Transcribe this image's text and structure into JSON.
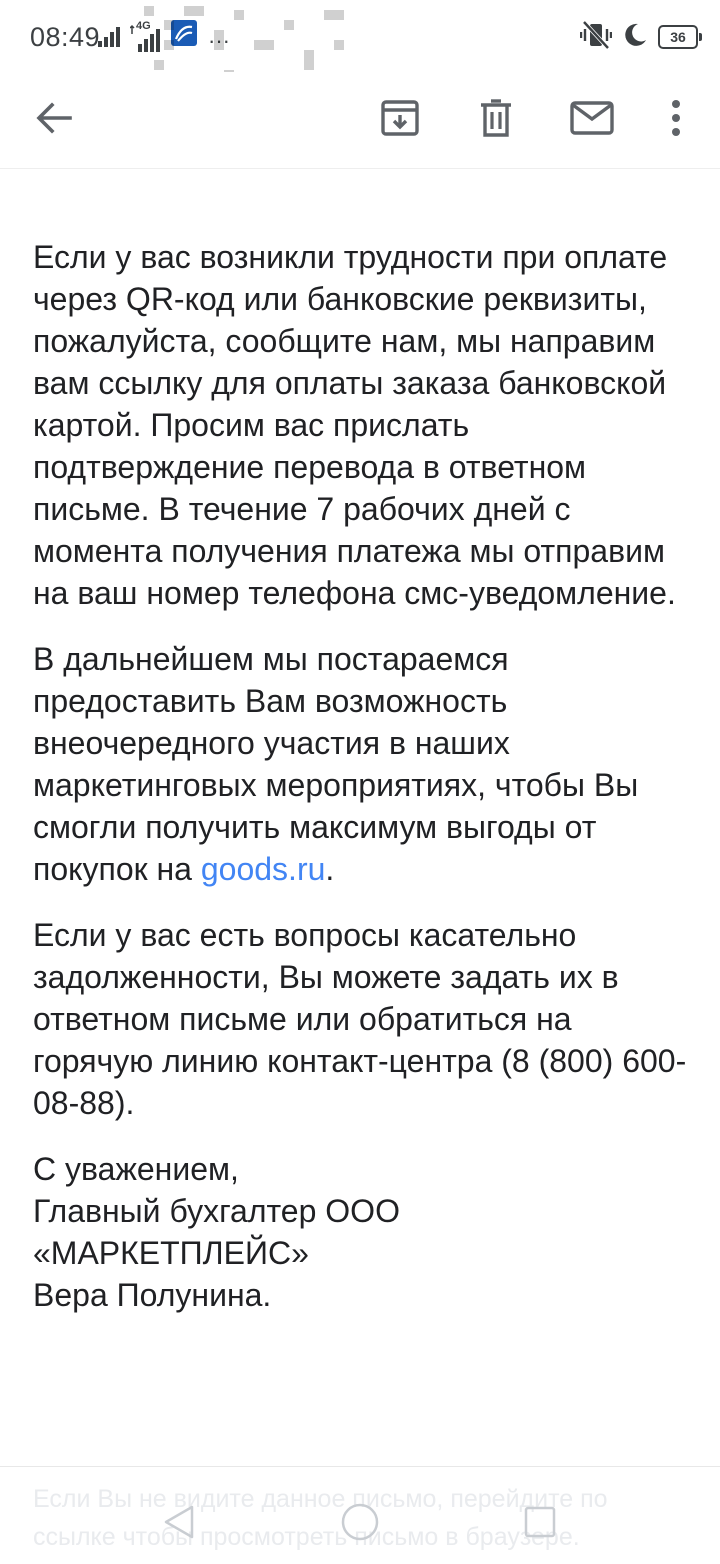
{
  "status_bar": {
    "time": "08:49",
    "network_type": "4G",
    "more_indicator": "···",
    "battery_level": "36",
    "icons": [
      "signal-icon",
      "signal-4g-icon",
      "app-notification-icon",
      "more-icon",
      "vibrate-off-icon",
      "do-not-disturb-moon-icon",
      "battery-icon"
    ]
  },
  "toolbar": {
    "icons": [
      "back-arrow-icon",
      "archive-icon",
      "trash-icon",
      "mail-icon",
      "more-vert-icon"
    ]
  },
  "email": {
    "paragraphs": [
      "Если у вас возникли трудности при оплате через QR-код или банковские реквизиты, пожалуйста, сообщите нам, мы направим вам ссылку для оплаты заказа банковской картой. Просим вас прислать подтверждение перевода в ответном письме. В течение 7 рабочих дней с момента получения платежа мы отправим на ваш номер телефона смс-уведомление."
    ],
    "paragraph2_text": "В дальнейшем мы постараемся предоставить Вам возможность внеочередного участия в наших маркетинговых мероприятиях, чтобы Вы смогли получить максимум выгоды от покупок на ",
    "paragraph2_link": "goods.ru",
    "paragraph2_end": ".",
    "paragraph3": "Если у вас есть вопросы касательно задолженности, Вы можете задать их в ответном письме или обратиться на горячую линию контакт-центра (8 (800) 600-08-88).",
    "signature": {
      "line1": "С уважением,",
      "line2": "Главный бухгалтер ООО",
      "line3": "«МАРКЕТПЛЕЙС»",
      "line4": "Вера Полунина."
    },
    "footer_faded": "Если Вы не видите данное письмо, перейдите по ссылке чтобы просмотреть письмо в браузере."
  },
  "nav_bar": {
    "icons": [
      "nav-back-triangle-icon",
      "nav-home-circle-icon",
      "nav-recent-square-icon"
    ]
  }
}
